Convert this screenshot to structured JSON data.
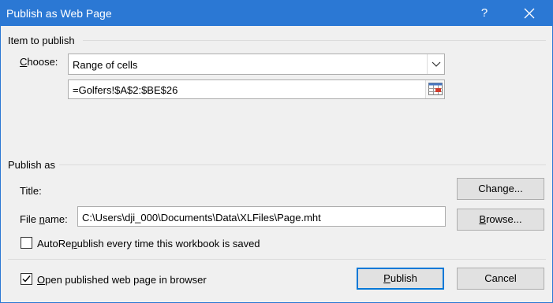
{
  "window": {
    "title": "Publish as Web Page",
    "help_glyph": "?"
  },
  "item_to_publish": {
    "group_label": "Item to publish",
    "choose_label_prefix": "",
    "choose_label_accel": "C",
    "choose_label_rest": "hoose:",
    "choose_value": "Range of cells",
    "range_value": "=Golfers!$A$2:$BE$26"
  },
  "publish_as": {
    "group_label": "Publish as",
    "title_label": "Title:",
    "change_button_pre": "Chan",
    "change_button_accel": "g",
    "change_button_post": "e...",
    "file_name_label_pre": "File ",
    "file_name_label_accel": "n",
    "file_name_label_post": "ame:",
    "file_name_value": "C:\\Users\\dji_000\\Documents\\Data\\XLFiles\\Page.mht",
    "browse_button_accel": "B",
    "browse_button_post": "rowse...",
    "autorepublish_pre": "AutoRe",
    "autorepublish_accel": "p",
    "autorepublish_post": "ublish every time this workbook is saved",
    "autorepublish_checked": false
  },
  "footer": {
    "open_in_browser_accel": "O",
    "open_in_browser_post": "pen published web page in browser",
    "open_in_browser_checked": true,
    "publish_button_accel": "P",
    "publish_button_post": "ublish",
    "cancel_button": "Cancel"
  },
  "colors": {
    "titlebar": "#2b78d4",
    "accent": "#0078d7"
  }
}
